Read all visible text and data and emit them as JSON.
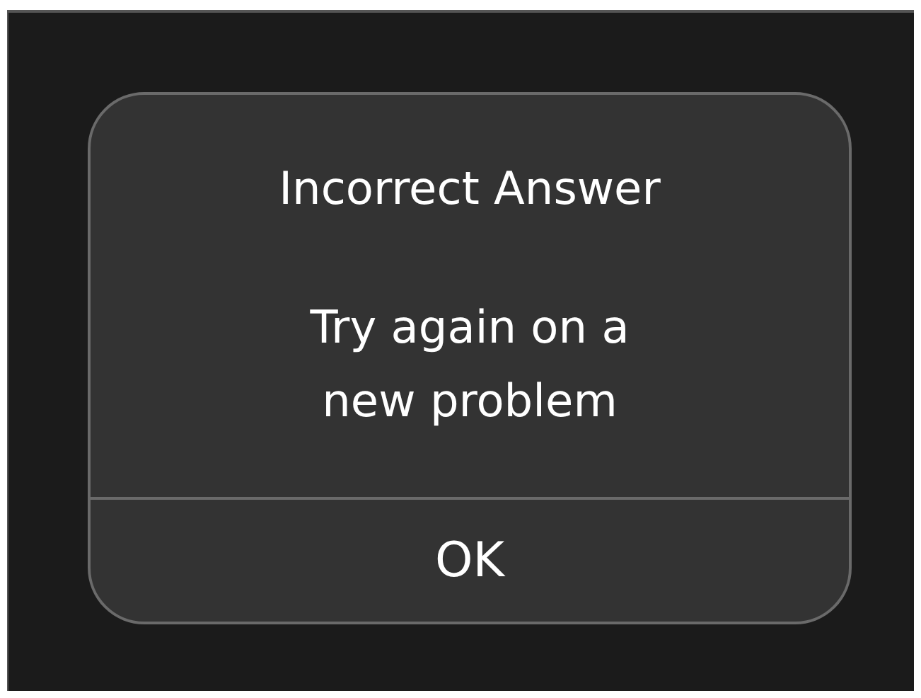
{
  "dialog": {
    "title": "Incorrect Answer",
    "message": "Try again on a new problem",
    "buttons": [
      "OK"
    ]
  }
}
